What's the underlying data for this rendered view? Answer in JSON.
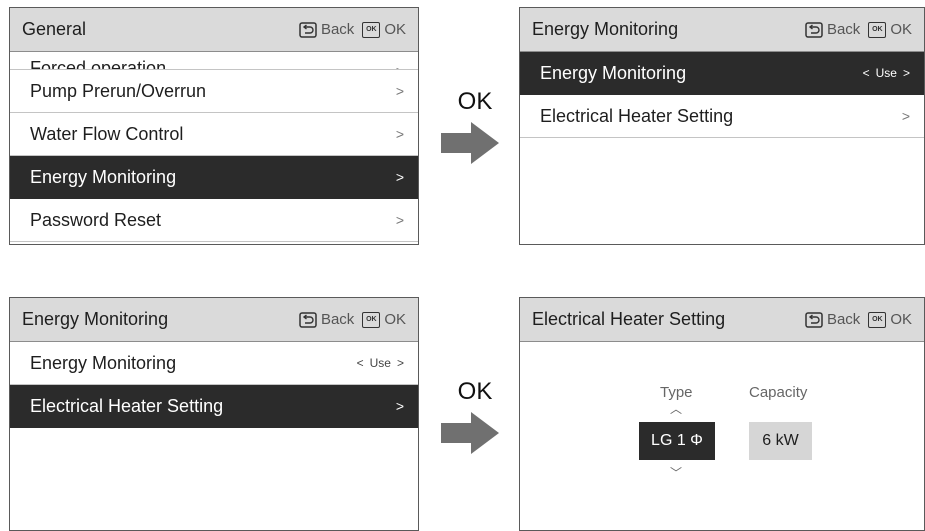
{
  "header": {
    "back_label": "Back",
    "ok_label": "OK",
    "ok_icon_text": "OK"
  },
  "arrow_label": "OK",
  "panel1": {
    "title": "General",
    "items": [
      {
        "label": "Forced operation",
        "chevron": ">"
      },
      {
        "label": "Pump Prerun/Overrun",
        "chevron": ">"
      },
      {
        "label": "Water Flow Control",
        "chevron": ">"
      },
      {
        "label": "Energy Monitoring",
        "chevron": ">"
      },
      {
        "label": "Password Reset",
        "chevron": ">"
      }
    ]
  },
  "panel2": {
    "title": "Energy Monitoring",
    "items": [
      {
        "label": "Energy Monitoring",
        "left": "<",
        "value": "Use",
        "right": ">"
      },
      {
        "label": "Electrical Heater Setting",
        "chevron": ">"
      }
    ]
  },
  "panel3": {
    "title": "Energy Monitoring",
    "items": [
      {
        "label": "Energy Monitoring",
        "left": "<",
        "value": "Use",
        "right": ">"
      },
      {
        "label": "Electrical Heater Setting",
        "chevron": ">"
      }
    ]
  },
  "panel4": {
    "title": "Electrical Heater Setting",
    "type_label": "Type",
    "capacity_label": "Capacity",
    "type_value": "LG 1 Φ",
    "capacity_value": "6 kW",
    "up": "︿",
    "down": "﹀"
  },
  "colors": {
    "header_bg": "#dadada",
    "selected_bg": "#2b2b2b",
    "arrow": "#707070"
  }
}
